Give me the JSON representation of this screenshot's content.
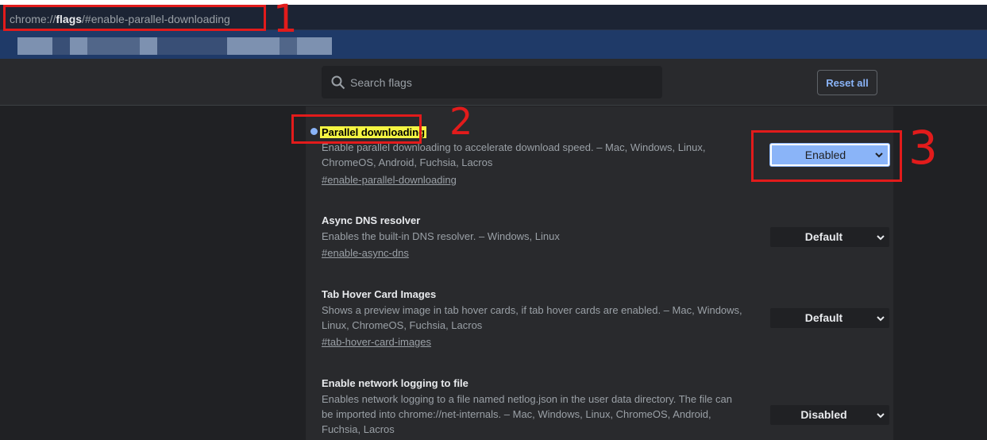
{
  "browser": {
    "url_prefix": "chrome://",
    "url_host": "flags",
    "url_suffix": "/#enable-parallel-downloading"
  },
  "header": {
    "search_placeholder": "Search flags",
    "reset_label": "Reset all"
  },
  "flags": [
    {
      "title": "Parallel downloading",
      "description": "Enable parallel downloading to accelerate download speed. – Mac, Windows, Linux, ChromeOS, Android, Fuchsia, Lacros",
      "link": "#enable-parallel-downloading",
      "value": "Enabled"
    },
    {
      "title": "Async DNS resolver",
      "description": "Enables the built-in DNS resolver. – Windows, Linux",
      "link": "#enable-async-dns",
      "value": "Default"
    },
    {
      "title": "Tab Hover Card Images",
      "description": "Shows a preview image in tab hover cards, if tab hover cards are enabled. – Mac, Windows, Linux, ChromeOS, Fuchsia, Lacros",
      "link": "#tab-hover-card-images",
      "value": "Default"
    },
    {
      "title": "Enable network logging to file",
      "description": "Enables network logging to a file named netlog.json in the user data directory. The file can be imported into chrome://net-internals. – Mac, Windows, Linux, ChromeOS, Android, Fuchsia, Lacros",
      "link": "",
      "value": "Disabled"
    }
  ],
  "annotations": {
    "one": "1",
    "two": "2",
    "three": "3",
    "color": "#e21b1b"
  },
  "colors": {
    "accent": "#8ab4f8",
    "highlight": "#f5f542",
    "background": "#202124"
  }
}
